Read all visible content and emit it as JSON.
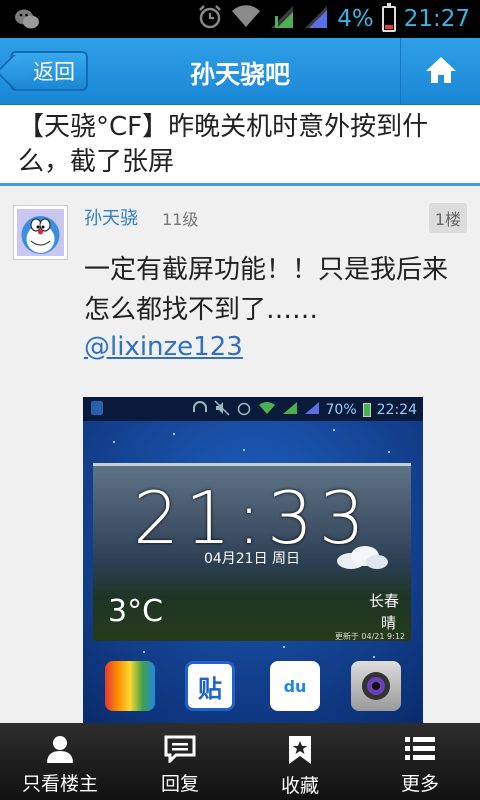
{
  "status_bar": {
    "battery_percent": "4%",
    "time": "21:27",
    "icons": [
      "wechat-icon",
      "alarm-icon",
      "wifi-icon",
      "signal-icon",
      "signal-icon-2",
      "battery-icon"
    ]
  },
  "header": {
    "back_label": "返回",
    "title": "孙天骁吧",
    "home_icon": "home-icon"
  },
  "post": {
    "title": "【天骁°CF】昨晚关机时意外按到什么，截了张屏",
    "author": "孙天骁",
    "level": "11级",
    "floor": "1楼",
    "content": "一定有截屏功能！！只是我后来怎么都找不到了……",
    "mention": "@lixinze123"
  },
  "screenshot": {
    "battery_percent": "70%",
    "status_time": "22:24",
    "clock": "21:33",
    "date": "04月21日  周日",
    "temperature": "3°C",
    "city": "长春",
    "weather": "晴",
    "updated": "更新于 04/21 9:12",
    "app_icon_label": "贴",
    "app_icon_du": "du"
  },
  "bottom_bar": {
    "tabs": [
      {
        "label": "只看楼主",
        "icon": "user-icon"
      },
      {
        "label": "回复",
        "icon": "reply-icon"
      },
      {
        "label": "收藏",
        "icon": "bookmark-icon"
      },
      {
        "label": "更多",
        "icon": "list-icon"
      }
    ]
  },
  "colors": {
    "header_blue": "#1a87d6",
    "status_blue": "#33b5e5",
    "link_blue": "#2f6fc9",
    "accent_line": "#3aa0e5"
  }
}
